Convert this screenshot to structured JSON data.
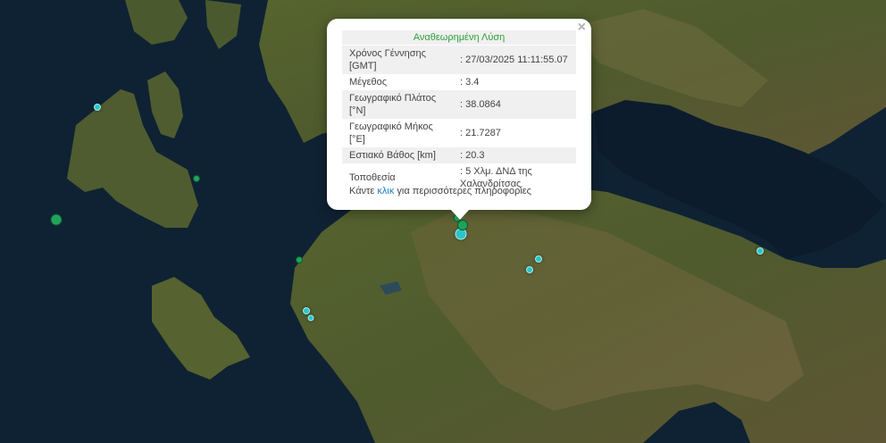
{
  "popup": {
    "title": "Αναθεωρημένη Λύση",
    "close": "×",
    "rows": [
      {
        "label_l1": "Χρόνος Γέννησης",
        "label_l2": "[GMT]",
        "value": ": 27/03/2025 11:11:55.07"
      },
      {
        "label_l1": "Μέγεθος",
        "label_l2": "",
        "value": ": 3.4"
      },
      {
        "label_l1": "Γεωγραφικό Πλάτος",
        "label_l2": "[°N]",
        "value": ": 38.0864"
      },
      {
        "label_l1": "Γεωγραφικό Μήκος",
        "label_l2": "[°E]",
        "value": ": 21.7287"
      },
      {
        "label_l1": "Εστιακό Βάθος [km]",
        "label_l2": "",
        "value": ": 20.3"
      },
      {
        "label_l1": "Τοποθεσία",
        "label_l2": "",
        "value": ": 5 Χλμ. ΔΝΔ της Χαλανδρίτσας"
      }
    ],
    "footer_before": "Κάντε ",
    "footer_link": "κλικ",
    "footer_after": " για περισσότερες πληροφορίες"
  },
  "colors": {
    "sea": "#0f2233",
    "land": "#4a5a2c",
    "recent_marker": "#2ec4c9",
    "older_marker": "#22a35a",
    "popup_title": "#2e9e3a",
    "link": "#1a7fc0"
  }
}
